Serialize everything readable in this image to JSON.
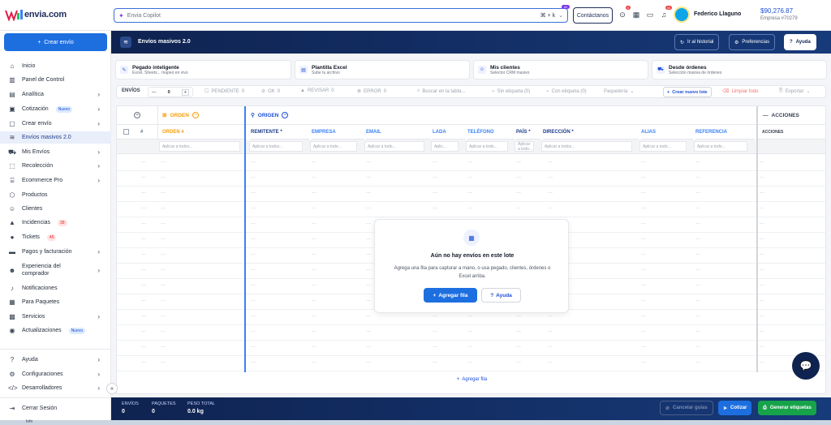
{
  "brand": {
    "name": "envia.com"
  },
  "topbar": {
    "copilot_placeholder": "Envia Copilot",
    "shortcut": "⌘ + k",
    "ai_badge": "AI",
    "contact_label": "Contáctanos",
    "notif_badge": "0",
    "cart_badge": "30",
    "user_name": "Federico Llaguno",
    "balance": "$90,276.87",
    "company": "Empresa #70279"
  },
  "sidebar": {
    "create_label": "Crear envío",
    "items": [
      {
        "label": "Inicio",
        "icon": "home-icon"
      },
      {
        "label": "Panel de Control",
        "icon": "chart-icon"
      },
      {
        "label": "Analítica",
        "icon": "analytics-icon",
        "chev": true
      },
      {
        "label": "Cotización",
        "icon": "quote-icon",
        "pill": "Nuevo",
        "chev": true
      },
      {
        "label": "Crear envío",
        "icon": "box-icon",
        "chev": true
      },
      {
        "label": "Envíos masivos 2.0",
        "icon": "layers-icon",
        "active": true
      },
      {
        "label": "Mis Envíos",
        "icon": "truck-icon",
        "chev": true
      },
      {
        "label": "Recolección",
        "icon": "pickup-icon",
        "chev": true
      },
      {
        "label": "Ecommerce Pro",
        "icon": "store-icon",
        "chev": true
      },
      {
        "label": "Productos",
        "icon": "product-icon"
      },
      {
        "label": "Clientes",
        "icon": "users-icon"
      },
      {
        "label": "Incidencias",
        "icon": "warning-icon",
        "red": "39"
      },
      {
        "label": "Tickets",
        "icon": "ticket-icon",
        "red": "45"
      },
      {
        "label": "Pagos y facturación",
        "icon": "payment-icon",
        "chev": true
      },
      {
        "label": "Experiencia del",
        "label2": "comprador",
        "icon": "experience-icon",
        "chev": true
      },
      {
        "label": "Notificaciones",
        "icon": "bell-icon"
      },
      {
        "label": "Para Paquetes",
        "icon": "package-icon"
      },
      {
        "label": "Servicios",
        "icon": "services-icon",
        "chev": true
      },
      {
        "label": "Actualizaciones",
        "icon": "update-icon",
        "pill": "Nuevo"
      },
      {
        "label": "Ayuda",
        "icon": "help-icon",
        "chev": true
      },
      {
        "label": "Configuraciones",
        "icon": "settings-icon",
        "chev": true
      },
      {
        "label": "Desarrolladores",
        "icon": "code-icon",
        "chev": true
      },
      {
        "label": "Cerrar Sesión",
        "icon": "logout-icon"
      }
    ]
  },
  "header": {
    "title": "Envíos masivos 2.0",
    "history": "Ir al historial",
    "prefs": "Preferencias",
    "help": "Ayuda"
  },
  "cards": [
    {
      "title": "Pegado inteligente",
      "sub": "Excel, Sheets... mapeo en vivo"
    },
    {
      "title": "Plantilla Excel",
      "sub": "Sube tu archivo"
    },
    {
      "title": "Mis clientes",
      "sub": "Selector CRM masivo"
    },
    {
      "title": "Desde órdenes",
      "sub": "Selección masiva de órdenes"
    }
  ],
  "toolbar": {
    "envios": "ENVÍOS",
    "count": "0",
    "pendiente": "PENDIENTE",
    "pendiente_n": "0",
    "ok": "OK",
    "ok_n": "0",
    "revisar": "REVISAR",
    "revisar_n": "0",
    "error": "ERROR",
    "error_n": "0",
    "search": "Buscar en la tabla...",
    "sin_etiqueta": "Sin etiqueta (0)",
    "con_etiqueta": "Con etiqueta (0)",
    "paqueteria": "Paquetería",
    "crear_lote": "Crear nuevo lote",
    "limpiar": "Limpiar todo",
    "exportar": "Exportar"
  },
  "grid": {
    "group_orden": "ORDEN",
    "group_origen": "ORIGEN",
    "group_acciones": "ACCIONES",
    "hash": "#",
    "col_orden": "ORDEN #",
    "cols": [
      "REMITENTE *",
      "EMPRESA",
      "EMAIL",
      "LADA",
      "TELÉFONO",
      "PAÍS *",
      "DIRECCIÓN *",
      "ALIAS",
      "REFERENCIA"
    ],
    "col_acciones": "ACCIONES",
    "filter_all": "Aplicar a todos...",
    "filter_short": "Aplicar a todo...",
    "filter_lada": "Aplic...",
    "add_row": "Agregar fila",
    "dash": "—"
  },
  "empty": {
    "title": "Aún no hay envíos en este lote",
    "desc": "Agrega una fila para capturar a mano, o usa pegado, clientes, órdenes o Excel arriba.",
    "add": "Agregar fila",
    "help": "Ayuda"
  },
  "footer": {
    "envios_label": "ENVÍOS",
    "envios": "0",
    "paquetes_label": "PAQUETES",
    "paquetes": "0",
    "peso_label": "PESO TOTAL",
    "peso": "0.0 kg",
    "cancel": "Cancelar guías",
    "cotizar": "Cotizar",
    "generar": "Generar etiquetas"
  },
  "bottom": {
    "label": "Info"
  }
}
